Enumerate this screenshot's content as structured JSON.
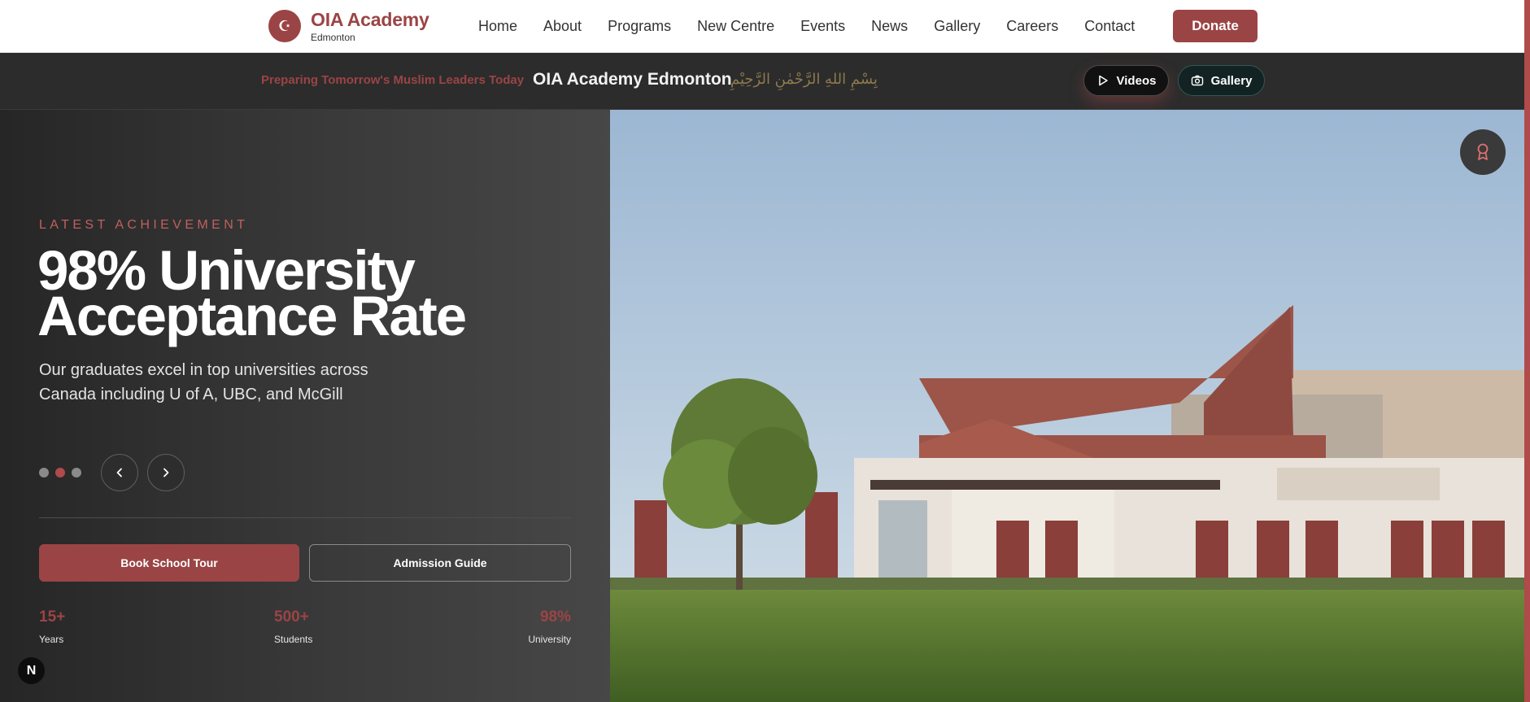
{
  "nav": {
    "logo_mark": "☪",
    "logo_title": "OIA Academy",
    "logo_sub": "Edmonton",
    "links": [
      "Home",
      "About",
      "Programs",
      "New Centre",
      "Events",
      "News",
      "Gallery",
      "Careers",
      "Contact"
    ],
    "donate": "Donate"
  },
  "banner": {
    "tagline": "Preparing Tomorrow's Muslim Leaders Today",
    "name": "OIA Academy Edmonton",
    "bismillah": "بِسْمِ اللهِ الرَّحْمٰنِ الرَّحِيْمِ",
    "videos": "Videos",
    "gallery": "Gallery"
  },
  "hero": {
    "eyebrow": "LATEST ACHIEVEMENT",
    "headline_line1": "98% University",
    "headline_line2": "Acceptance Rate",
    "description": "Our graduates excel in top universities across Canada including U of A, UBC, and McGill",
    "slides_total": 3,
    "active_slide": 2,
    "book_tour": "Book School Tour",
    "admission_guide": "Admission Guide",
    "stats": [
      {
        "value": "15+",
        "label": "Years"
      },
      {
        "value": "500+",
        "label": "Students"
      },
      {
        "value": "98%",
        "label": "University"
      }
    ],
    "fab_label": "N"
  },
  "colors": {
    "brand": "#9b4445",
    "accent_dot": "#b04a4b",
    "banner_bg": "#2c2c2c",
    "arabic_gold": "#8d7a4d"
  },
  "icons": {
    "videos": "play-icon",
    "gallery": "camera-icon",
    "award": "award-ribbon-icon",
    "prev": "chevron-left-icon",
    "next": "chevron-right-icon"
  }
}
